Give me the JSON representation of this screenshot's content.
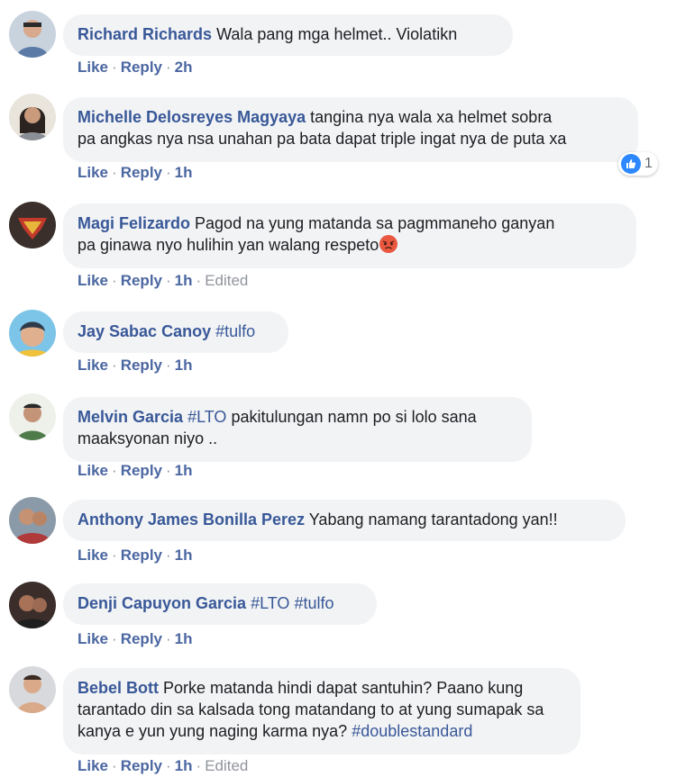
{
  "action_labels": {
    "like": "Like",
    "reply": "Reply",
    "separator": "·"
  },
  "comments": [
    {
      "author": "Richard Richards",
      "text": "Wala pang mga helmet.. Violatikn",
      "time": "2h",
      "edited": ""
    },
    {
      "author": "Michelle Delosreyes Magyaya",
      "text": "tangina nya wala xa helmet sobra",
      "text2": "pa angkas nya nsa unahan pa bata dapat triple ingat nya de puta xa",
      "time": "1h",
      "edited": "",
      "reaction_count": "1",
      "reaction_icon": "like-icon"
    },
    {
      "author": "Magi Felizardo",
      "text": "Pagod na yung matanda sa pagmmaneho ganyan",
      "text2": "pa ginawa nyo hulihin yan walang respeto",
      "emoji": "angry-face-icon",
      "time": "1h",
      "edited": "Edited"
    },
    {
      "author": "Jay Sabac Canoy",
      "hashtag": "#tulfo",
      "time": "1h",
      "edited": ""
    },
    {
      "author": "Melvin Garcia",
      "hashtag": "#LTO",
      "text": "pakitulungan namn po si lolo sana",
      "text2": "maaksyonan niyo ..",
      "time": "1h",
      "edited": ""
    },
    {
      "author": "Anthony James Bonilla Perez",
      "text": "Yabang namang tarantadong yan!!",
      "time": "1h",
      "edited": ""
    },
    {
      "author": "Denji Capuyon Garcia",
      "hashtag": "#LTO",
      "hashtag2": "#tulfo",
      "time": "1h",
      "edited": ""
    },
    {
      "author": "Bebel Bott",
      "text": "Porke matanda hindi dapat santuhin? Paano kung",
      "text2": "tarantado din sa kalsada tong matandang to at yung sumapak sa",
      "text3": "kanya e yun yung naging karma nya?",
      "hashtag": "#doublestandard",
      "time": "1h",
      "edited": "Edited"
    }
  ],
  "colors": {
    "name": "#385898",
    "bubble": "#f2f3f5",
    "meta": "#90949c",
    "like_blue": "#2d88ff"
  }
}
